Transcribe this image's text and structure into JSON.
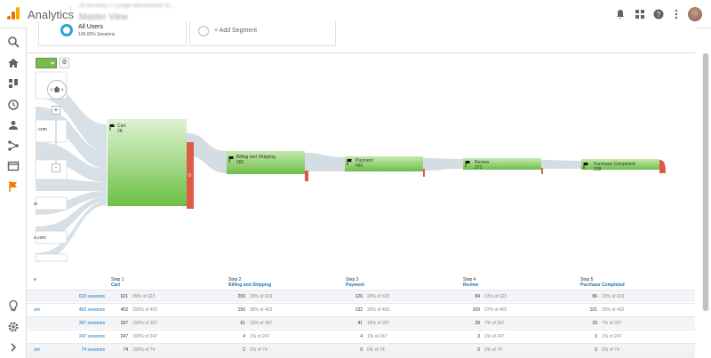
{
  "app": {
    "title": "Analytics",
    "account_small": "All accounts > Google Merchandise St...",
    "view_name": "Master View"
  },
  "segments": {
    "active_name": "All Users",
    "active_sub": "100.00% Sessions",
    "add_label": "+ Add Segment"
  },
  "controls": {
    "gear": "⚙",
    "zoom_in": "+",
    "zoom_out": "-"
  },
  "sources": [
    {
      "label": ".com"
    },
    {
      "label": "m"
    },
    {
      "label": "e.com"
    }
  ],
  "funnel_nodes": [
    {
      "name": "Cart",
      "value": "2K"
    },
    {
      "name": "Billing and Shipping",
      "value": "582"
    },
    {
      "name": "Payment",
      "value": "491"
    },
    {
      "name": "Review",
      "value": "273"
    },
    {
      "name": "Purchase Completed",
      "value": "238"
    }
  ],
  "drop_marker": "0",
  "table": {
    "first_col_header": "e",
    "steps": [
      {
        "step": "Step 1",
        "name": "Cart"
      },
      {
        "step": "Step 2",
        "name": "Billing and Shipping"
      },
      {
        "step": "Step 3",
        "name": "Payment"
      },
      {
        "step": "Step 4",
        "name": "Review"
      },
      {
        "step": "Step 5",
        "name": "Purchase Completed"
      }
    ],
    "rows": [
      {
        "source": "",
        "sessions": "623 sessions",
        "cells": [
          [
            "621",
            "99% of 623"
          ],
          [
            "209",
            "33% of 623"
          ],
          [
            "126",
            "20% of 623"
          ],
          [
            "84",
            "13% of 623"
          ],
          [
            "86",
            "13% of 623"
          ]
        ]
      },
      {
        "source": "om",
        "sessions": "402 sessions",
        "cells": [
          [
            "402",
            "100% of 402"
          ],
          [
            "156",
            "38% of 402"
          ],
          [
            "132",
            "32% of 402"
          ],
          [
            "109",
            "27% of 402"
          ],
          [
            "101",
            "25% of 402"
          ]
        ]
      },
      {
        "source": "",
        "sessions": "397 sessions",
        "cells": [
          [
            "397",
            "100% of 397"
          ],
          [
            "61",
            "15% of 397"
          ],
          [
            "41",
            "10% of 397"
          ],
          [
            "28",
            "7% of 397"
          ],
          [
            "29",
            "7% of 397"
          ]
        ]
      },
      {
        "source": "",
        "sessions": "247 sessions",
        "cells": [
          [
            "247",
            "100% of 247"
          ],
          [
            "4",
            "1% of 247"
          ],
          [
            "4",
            "1% of 247"
          ],
          [
            "3",
            "1% of 247"
          ],
          [
            "3",
            "1% of 247"
          ]
        ]
      },
      {
        "source": "om",
        "sessions": "74 sessions",
        "cells": [
          [
            "74",
            "100% of 74"
          ],
          [
            "2",
            "2% of 74"
          ],
          [
            "0",
            "0% of 74"
          ],
          [
            "0",
            "0% of 74"
          ],
          [
            "0",
            "0% of 74"
          ]
        ]
      }
    ]
  },
  "colors": {
    "node_green": "#8fd06a",
    "node_dark": "#6cbf45",
    "drop_red": "#e05a4a",
    "flow_gray": "#d3dde3",
    "link_blue": "#1a73b8",
    "ga_orange": "#f57c00"
  }
}
